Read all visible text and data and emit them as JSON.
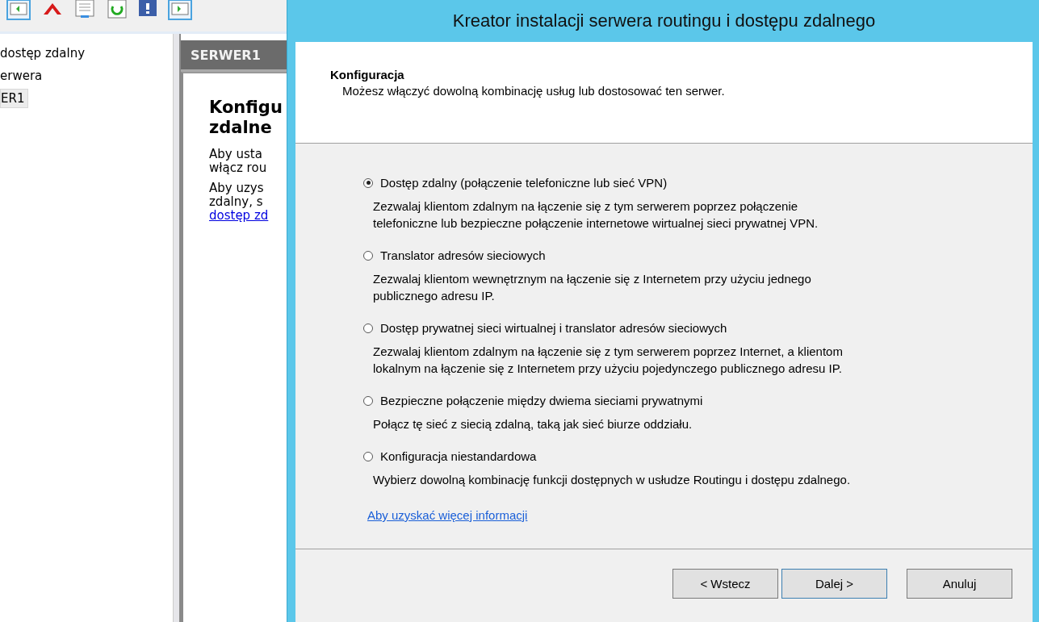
{
  "background_window": {
    "tree": {
      "items": [
        {
          "label": "dostęp zdalny",
          "selected": false
        },
        {
          "label": "erwera",
          "selected": false
        },
        {
          "label": "ER1",
          "selected": true
        }
      ]
    },
    "details": {
      "header": "SERWER1",
      "heading_lines": [
        "Konfigu",
        "zdalne"
      ],
      "paragraphs": [
        [
          "Aby usta",
          "włącz rou"
        ],
        [
          "Aby uzys",
          "zdalny, s"
        ]
      ],
      "link": "dostęp zd"
    }
  },
  "dialog": {
    "title": "Kreator instalacji serwera routingu i dostępu zdalnego",
    "header": {
      "title": "Konfiguracja",
      "subtitle": "Możesz włączyć dowolną kombinację usług lub dostosować ten serwer."
    },
    "options": [
      {
        "label": "Dostęp zdalny (połączenie telefoniczne lub sieć VPN)",
        "description": "Zezwalaj klientom zdalnym na łączenie się z tym serwerem poprzez połączenie\ntelefoniczne lub bezpieczne połączenie internetowe wirtualnej sieci prywatnej VPN.",
        "selected": true
      },
      {
        "label": "Translator adresów sieciowych",
        "description": "Zezwalaj klientom wewnętrznym na łączenie się z Internetem przy użyciu jednego\npublicznego adresu IP.",
        "selected": false
      },
      {
        "label": "Dostęp prywatnej sieci wirtualnej i translator adresów sieciowych",
        "description": "Zezwalaj klientom zdalnym na łączenie się z tym serwerem poprzez Internet, a klientom\nlokalnym na łączenie się z Internetem przy użyciu pojedynczego publicznego adresu IP.",
        "selected": false
      },
      {
        "label": "Bezpieczne połączenie między dwiema sieciami prywatnymi",
        "description": "Połącz tę sieć z siecią zdalną, taką jak sieć biurze oddziału.",
        "selected": false
      },
      {
        "label": "Konfiguracja niestandardowa",
        "description": "Wybierz dowolną kombinację funkcji dostępnych w usłudze Routingu i dostępu zdalnego.",
        "selected": false
      }
    ],
    "link": "Aby uzyskać więcej informacji",
    "buttons": [
      {
        "label": "< Wstecz",
        "default": false
      },
      {
        "label": "Dalej >",
        "default": true
      },
      {
        "label": "Anuluj",
        "default": false
      }
    ]
  }
}
